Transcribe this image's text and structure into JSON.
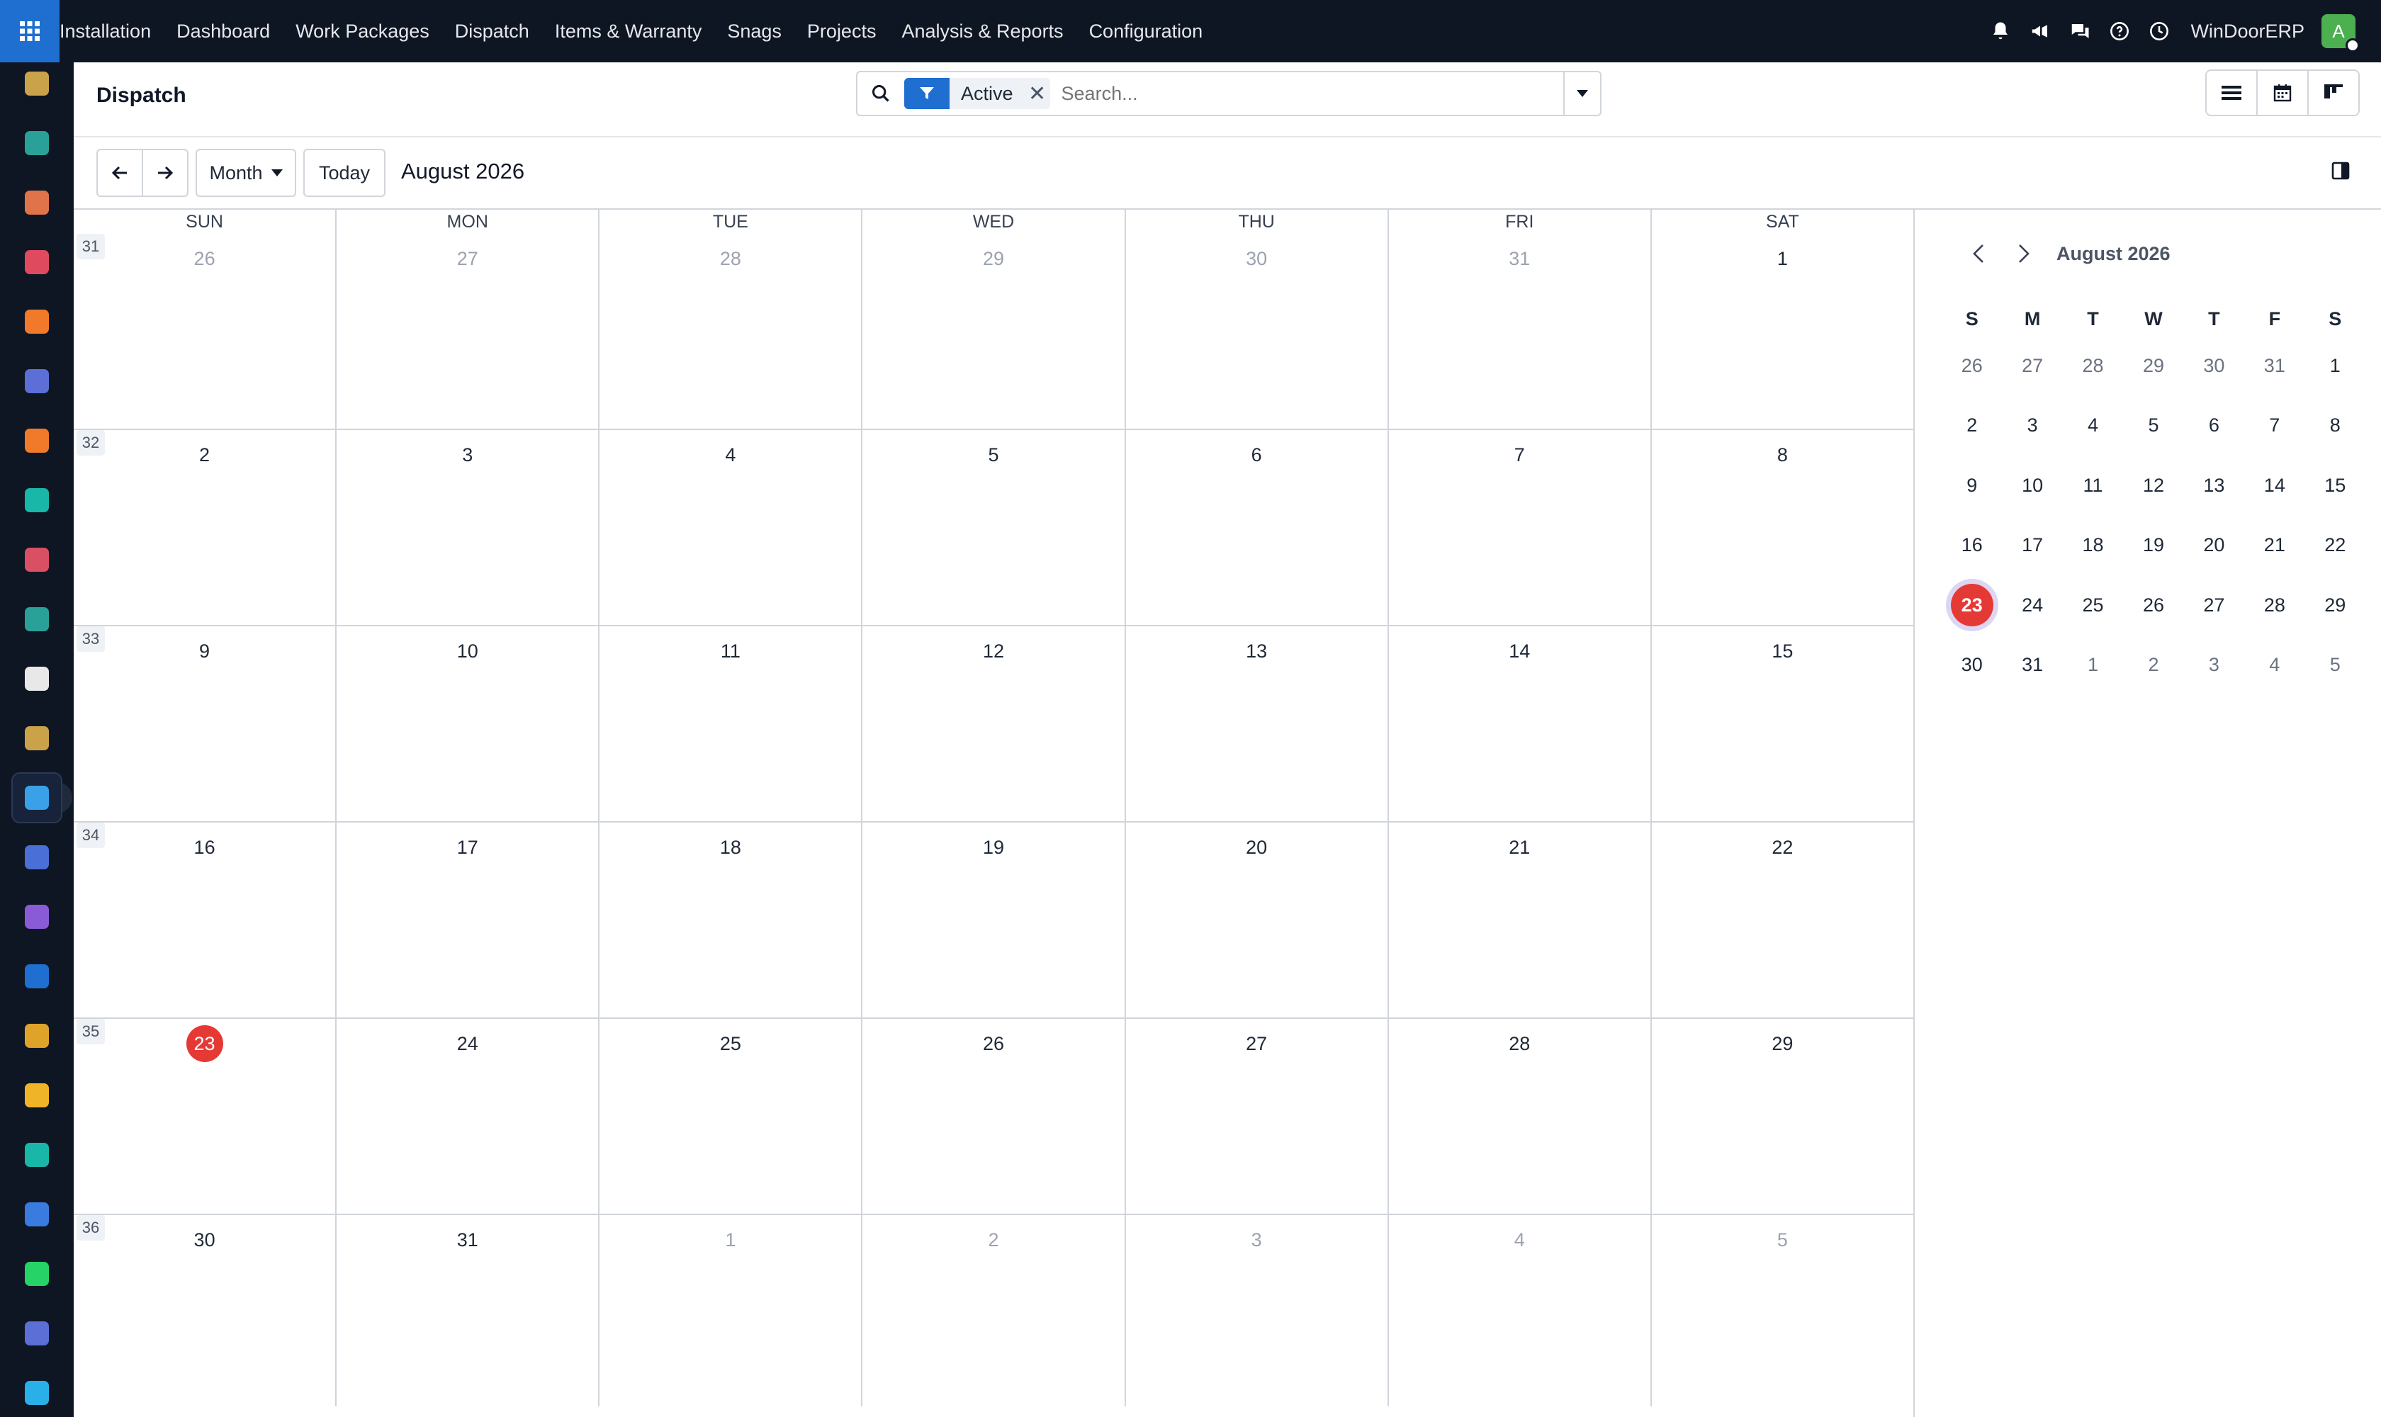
{
  "navbar": {
    "menu": [
      "Installation",
      "Dashboard",
      "Work Packages",
      "Dispatch",
      "Items & Warranty",
      "Snags",
      "Projects",
      "Analysis & Reports",
      "Configuration"
    ],
    "company": "WinDoorERP",
    "avatar_letter": "A",
    "icons": [
      "bell-icon",
      "megaphone-icon",
      "chat-icon",
      "help-icon",
      "clock-icon"
    ]
  },
  "rail": {
    "apps": [
      {
        "icon": "app-installation-icon",
        "color": "#c9a24a"
      },
      {
        "icon": "app-contacts-icon",
        "color": "#2aa198"
      },
      {
        "icon": "app-reports-icon",
        "color": "#e0734a"
      },
      {
        "icon": "app-dashboard-icon",
        "color": "#e04a5f"
      },
      {
        "icon": "app-discuss-icon",
        "color": "#f07a2a"
      },
      {
        "icon": "app-mail-icon",
        "color": "#5b6fd6"
      },
      {
        "icon": "app-livechat-icon",
        "color": "#f07a2a"
      },
      {
        "icon": "app-project-icon",
        "color": "#19b7a8"
      },
      {
        "icon": "app-analytics-icon",
        "color": "#d94f63"
      },
      {
        "icon": "app-employees-icon",
        "color": "#2aa198"
      },
      {
        "icon": "app-inventory-icon",
        "color": "#e8e8e8"
      },
      {
        "icon": "app-workpackages-icon",
        "color": "#c9a24a"
      },
      {
        "icon": "app-dispatch-icon",
        "color": "#3aa0e8"
      },
      {
        "icon": "app-knowledge-icon",
        "color": "#4a6fd6"
      },
      {
        "icon": "app-items-icon",
        "color": "#8a5bd6"
      },
      {
        "icon": "app-invoicing-icon",
        "color": "#1e6fd0"
      },
      {
        "icon": "app-team-icon",
        "color": "#e0a32a"
      },
      {
        "icon": "app-calendar-icon",
        "color": "#f0b429"
      },
      {
        "icon": "app-sign-icon",
        "color": "#19b7a8"
      },
      {
        "icon": "app-website-icon",
        "color": "#3a7be0"
      },
      {
        "icon": "app-whatsapp-icon",
        "color": "#25d366"
      },
      {
        "icon": "app-timer-icon",
        "color": "#5b6fd6"
      },
      {
        "icon": "app-sync-icon",
        "color": "#2ab0e8"
      }
    ],
    "active_index": 12
  },
  "control": {
    "title": "Dispatch",
    "facet_value": "Active",
    "search_placeholder": "Search...",
    "scale_label": "Month",
    "today_label": "Today",
    "period_title": "August 2026"
  },
  "calendar": {
    "weekdays": [
      "SUN",
      "MON",
      "TUE",
      "WED",
      "THU",
      "FRI",
      "SAT"
    ],
    "weeks": [
      {
        "num": "31",
        "days": [
          {
            "d": "26",
            "o": true
          },
          {
            "d": "27",
            "o": true
          },
          {
            "d": "28",
            "o": true
          },
          {
            "d": "29",
            "o": true
          },
          {
            "d": "30",
            "o": true
          },
          {
            "d": "31",
            "o": true
          },
          {
            "d": "1"
          }
        ]
      },
      {
        "num": "32",
        "days": [
          {
            "d": "2"
          },
          {
            "d": "3"
          },
          {
            "d": "4"
          },
          {
            "d": "5"
          },
          {
            "d": "6"
          },
          {
            "d": "7"
          },
          {
            "d": "8"
          }
        ]
      },
      {
        "num": "33",
        "days": [
          {
            "d": "9"
          },
          {
            "d": "10"
          },
          {
            "d": "11"
          },
          {
            "d": "12"
          },
          {
            "d": "13"
          },
          {
            "d": "14"
          },
          {
            "d": "15"
          }
        ]
      },
      {
        "num": "34",
        "days": [
          {
            "d": "16"
          },
          {
            "d": "17"
          },
          {
            "d": "18"
          },
          {
            "d": "19"
          },
          {
            "d": "20"
          },
          {
            "d": "21"
          },
          {
            "d": "22"
          }
        ]
      },
      {
        "num": "35",
        "days": [
          {
            "d": "23",
            "t": true
          },
          {
            "d": "24"
          },
          {
            "d": "25"
          },
          {
            "d": "26"
          },
          {
            "d": "27"
          },
          {
            "d": "28"
          },
          {
            "d": "29"
          }
        ]
      },
      {
        "num": "36",
        "days": [
          {
            "d": "30"
          },
          {
            "d": "31"
          },
          {
            "d": "1",
            "o": true
          },
          {
            "d": "2",
            "o": true
          },
          {
            "d": "3",
            "o": true
          },
          {
            "d": "4",
            "o": true
          },
          {
            "d": "5",
            "o": true
          }
        ]
      }
    ]
  },
  "mini": {
    "title": "August 2026",
    "weekdays": [
      "S",
      "M",
      "T",
      "W",
      "T",
      "F",
      "S"
    ],
    "rows": [
      [
        {
          "d": "26",
          "o": true
        },
        {
          "d": "27",
          "o": true
        },
        {
          "d": "28",
          "o": true
        },
        {
          "d": "29",
          "o": true
        },
        {
          "d": "30",
          "o": true
        },
        {
          "d": "31",
          "o": true
        },
        {
          "d": "1"
        }
      ],
      [
        {
          "d": "2"
        },
        {
          "d": "3"
        },
        {
          "d": "4"
        },
        {
          "d": "5"
        },
        {
          "d": "6"
        },
        {
          "d": "7"
        },
        {
          "d": "8"
        }
      ],
      [
        {
          "d": "9"
        },
        {
          "d": "10"
        },
        {
          "d": "11"
        },
        {
          "d": "12"
        },
        {
          "d": "13"
        },
        {
          "d": "14"
        },
        {
          "d": "15"
        }
      ],
      [
        {
          "d": "16"
        },
        {
          "d": "17"
        },
        {
          "d": "18"
        },
        {
          "d": "19"
        },
        {
          "d": "20"
        },
        {
          "d": "21"
        },
        {
          "d": "22"
        }
      ],
      [
        {
          "d": "23",
          "s": true
        },
        {
          "d": "24"
        },
        {
          "d": "25"
        },
        {
          "d": "26"
        },
        {
          "d": "27"
        },
        {
          "d": "28"
        },
        {
          "d": "29"
        }
      ],
      [
        {
          "d": "30"
        },
        {
          "d": "31"
        },
        {
          "d": "1",
          "o": true
        },
        {
          "d": "2",
          "o": true
        },
        {
          "d": "3",
          "o": true
        },
        {
          "d": "4",
          "o": true
        },
        {
          "d": "5",
          "o": true
        }
      ]
    ]
  },
  "colors": {
    "navbar_bg": "#0f1623",
    "accent": "#1e6fd0",
    "today": "#e53935",
    "avatar": "#4caf50"
  }
}
